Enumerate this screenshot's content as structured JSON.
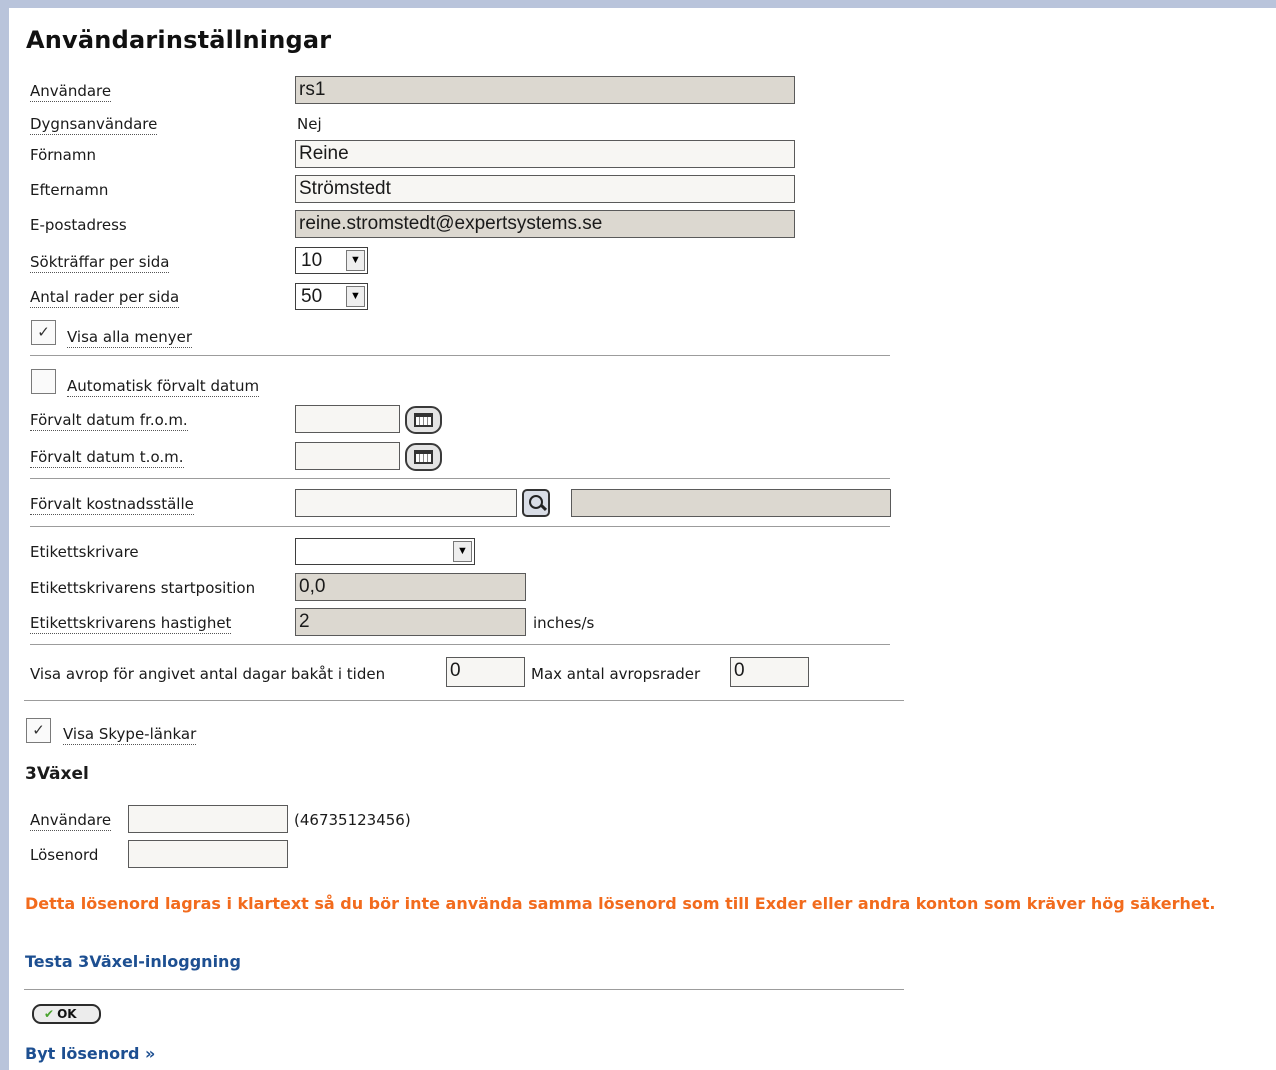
{
  "page_title": "Användarinställningar",
  "user": {
    "username_label": "Användare",
    "username_value": "rs1",
    "day_user_label": "Dygnsanvändare",
    "day_user_value": "Nej",
    "firstname_label": "Förnamn",
    "firstname_value": "Reine",
    "lastname_label": "Efternamn",
    "lastname_value": "Strömstedt",
    "email_label": "E-postadress",
    "email_value": "reine.stromstedt@expertsystems.se"
  },
  "paging": {
    "hits_label": "Sökträffar per sida",
    "hits_value": "10",
    "rows_label": "Antal rader per sida",
    "rows_value": "50"
  },
  "menus": {
    "show_all_label": "Visa alla menyer",
    "show_all_checked": true
  },
  "dates": {
    "auto_label": "Automatisk förvalt datum",
    "auto_checked": false,
    "from_label": "Förvalt datum fr.o.m.",
    "from_value": "",
    "to_label": "Förvalt datum t.o.m.",
    "to_value": ""
  },
  "cost_center": {
    "label": "Förvalt kostnadsställe",
    "code_value": "",
    "name_value": ""
  },
  "label_printer": {
    "printer_label": "Etikettskrivare",
    "printer_value": "",
    "start_label": "Etikettskrivarens startposition",
    "start_value": "0,0",
    "speed_label": "Etikettskrivarens hastighet",
    "speed_value": "2",
    "speed_unit": "inches/s"
  },
  "calloff": {
    "days_label": "Visa avrop för angivet antal dagar bakåt i tiden",
    "days_value": "0",
    "max_label": "Max antal avropsrader",
    "max_value": "0"
  },
  "skype": {
    "label": "Visa Skype-länkar",
    "checked": true
  },
  "vaxel": {
    "heading": "3Växel",
    "user_label": "Användare",
    "user_value": "",
    "user_hint": "(46735123456)",
    "password_label": "Lösenord",
    "password_value": "",
    "warning": "Detta lösenord lagras i klartext så du bör inte använda samma lösenord som till Exder eller andra konton som kräver hög säkerhet.",
    "test_link": "Testa 3Växel-inloggning"
  },
  "actions": {
    "ok_label": "OK",
    "change_password_link": "Byt lösenord »"
  },
  "colors": {
    "warning": "#f26b1d",
    "link": "#1d4f91",
    "readonly_bg": "#dcd8d0",
    "frame": "#b9c4db"
  }
}
